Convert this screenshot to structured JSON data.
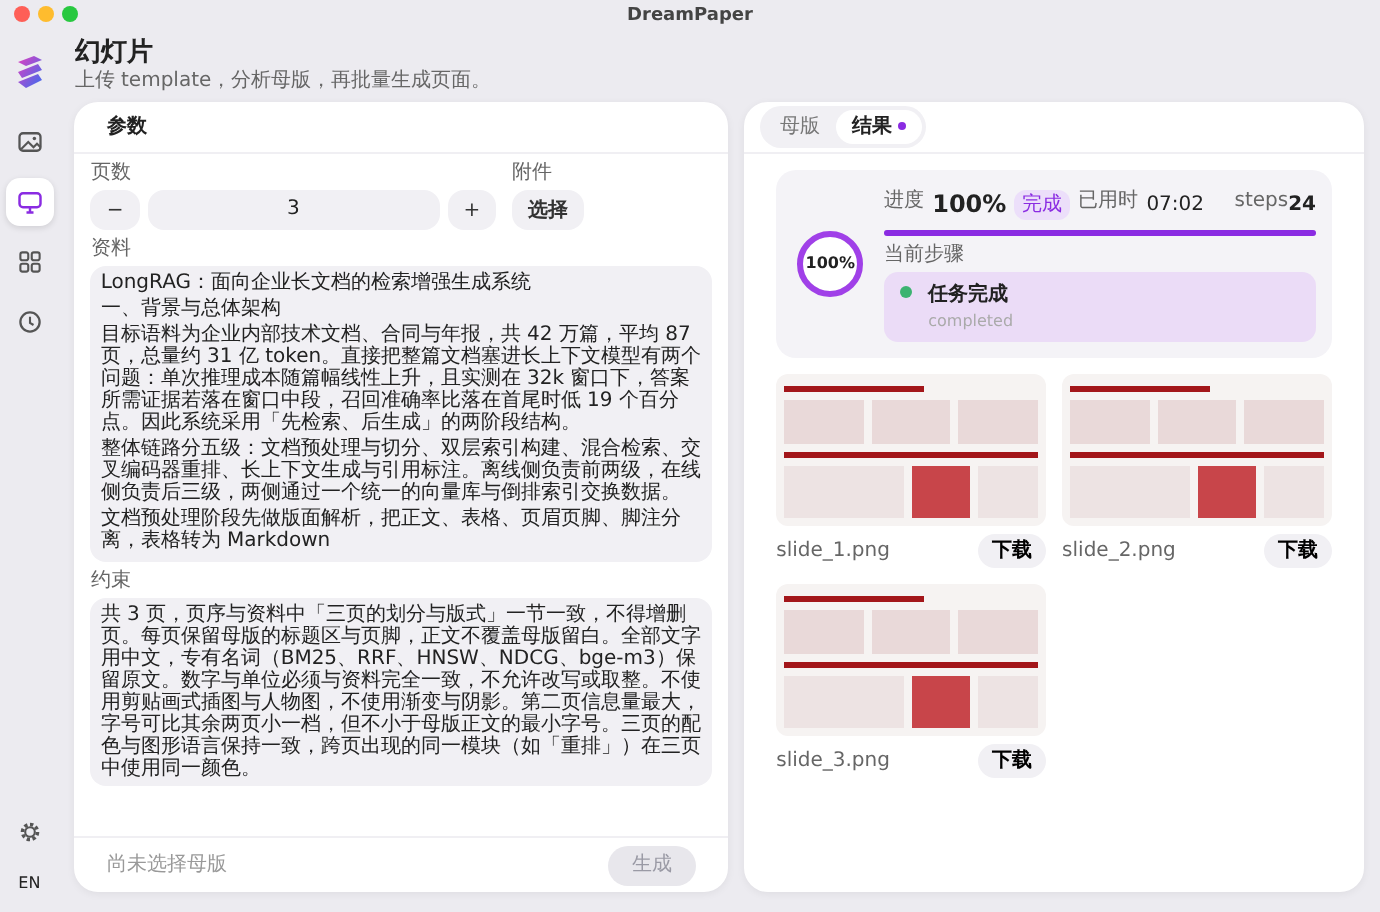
{
  "window": {
    "title": "DreamPaper"
  },
  "sidebar": {
    "items": [
      {
        "kind": "image",
        "selected": false
      },
      {
        "kind": "monitor",
        "selected": true
      },
      {
        "kind": "grid",
        "selected": false
      },
      {
        "kind": "clock",
        "selected": false
      }
    ],
    "language": "EN"
  },
  "page": {
    "title": "幻灯片",
    "subtitle": "上传 template，分析母版，再批量生成页面。"
  },
  "params": {
    "title": "参数",
    "pages": {
      "label": "页数",
      "minus": "−",
      "value": "3",
      "plus": "+"
    },
    "attachment": {
      "label": "附件",
      "button": "选择"
    },
    "material": {
      "label": "资料",
      "paragraphs": [
        "LongRAG：面向企业长文档的检索增强生成系统",
        "一、背景与总体架构",
        "目标语料为企业内部技术文档、合同与年报，共 42 万篇，平均 87 页，总量约 31 亿 token。直接把整篇文档塞进长上下文模型有两个问题：单次推理成本随篇幅线性上升，且实测在 32k 窗口下，答案所需证据若落在窗口中段，召回准确率比落在首尾时低 19 个百分点。因此系统采用「先检索、后生成」的两阶段结构。",
        "整体链路分五级：文档预处理与切分、双层索引构建、混合检索、交叉编码器重排、长上下文生成与引用标注。离线侧负责前两级，在线侧负责后三级，两侧通过一个统一的向量库与倒排索引交换数据。",
        "文档预处理阶段先做版面解析，把正文、表格、页眉页脚、脚注分离，表格转为 Markdown"
      ]
    },
    "constraints": {
      "label": "约束",
      "text": "共 3 页，页序与资料中「三页的划分与版式」一节一致，不得增删页。每页保留母版的标题区与页脚，正文不覆盖母版留白。全部文字用中文，专有名词（BM25、RRF、HNSW、NDCG、bge-m3）保留原文。数字与单位必须与资料完全一致，不允许改写或取整。不使用剪贴画式插图与人物图，不使用渐变与阴影。第二页信息量最大，字号可比其余两页小一档，但不小于母版正文的最小字号。三页的配色与图形语言保持一致，跨页出现的同一模块（如「重排」）在三页中使用同一颜色。"
    },
    "footer": {
      "status": "尚未选择母版",
      "button": "生成",
      "disabled": true
    }
  },
  "results": {
    "tabs": [
      {
        "label": "母版",
        "selected": false,
        "dot": false
      },
      {
        "label": "结果",
        "selected": true,
        "dot": true
      }
    ],
    "progress": {
      "ring_label": "100%",
      "level": 1,
      "label": "进度",
      "percent": "100%",
      "status": "完成",
      "elapsed_label": "已用时",
      "elapsed": "07:02",
      "steps_label": "steps",
      "steps": "24",
      "step_heading": "当前步骤",
      "step_title": "任务完成",
      "step_subtitle": "completed"
    },
    "files": [
      {
        "name": "slide_1.png",
        "button": "下载"
      },
      {
        "name": "slide_2.png",
        "button": "下载"
      },
      {
        "name": "slide_3.png",
        "button": "下载"
      }
    ]
  }
}
